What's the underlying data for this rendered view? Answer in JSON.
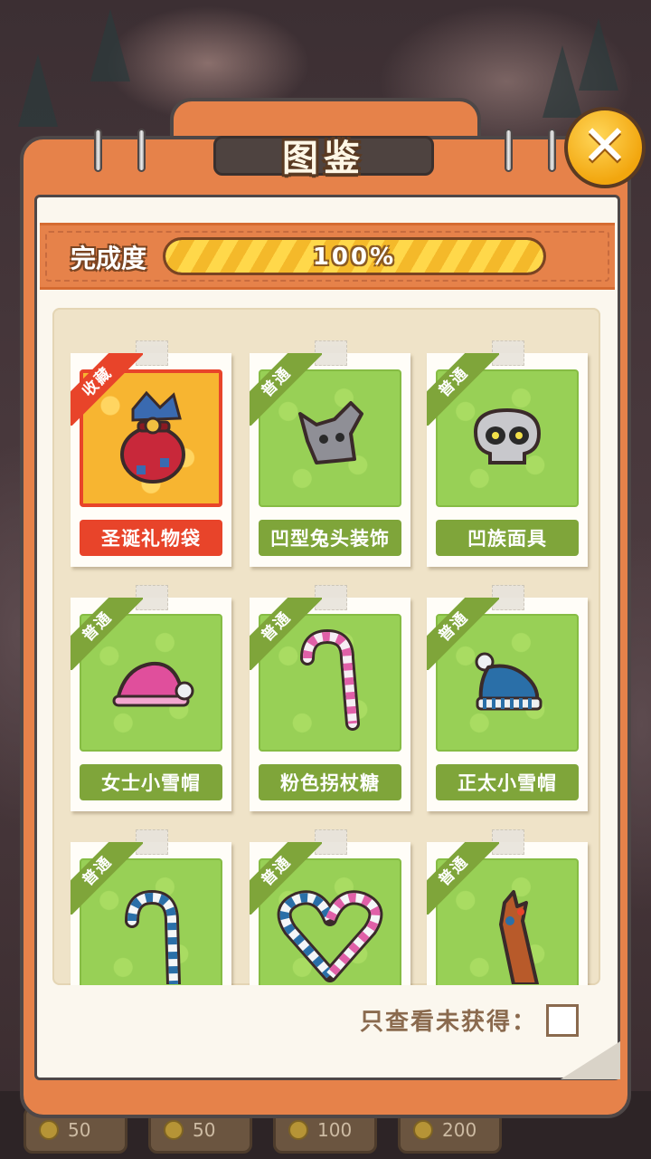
{
  "title": "图鉴",
  "close_symbol": "✕",
  "completion": {
    "label": "完成度",
    "percent": 100,
    "text": "100%"
  },
  "cards": [
    {
      "tag": "收藏",
      "name": "圣诞礼物袋",
      "rarity": "rare",
      "icon": "gift-sack-icon"
    },
    {
      "tag": "普通",
      "name": "凹型兔头装饰",
      "rarity": "common",
      "icon": "rabbit-head-icon"
    },
    {
      "tag": "普通",
      "name": "凹族面具",
      "rarity": "common",
      "icon": "skull-mask-icon"
    },
    {
      "tag": "普通",
      "name": "女士小雪帽",
      "rarity": "common",
      "icon": "pink-santa-hat-icon"
    },
    {
      "tag": "普通",
      "name": "粉色拐杖糖",
      "rarity": "common",
      "icon": "pink-candy-cane-icon"
    },
    {
      "tag": "普通",
      "name": "正太小雪帽",
      "rarity": "common",
      "icon": "blue-beanie-icon"
    },
    {
      "tag": "普通",
      "name": "",
      "rarity": "common",
      "icon": "blue-candy-cane-icon"
    },
    {
      "tag": "普通",
      "name": "",
      "rarity": "common",
      "icon": "candy-cane-heart-icon"
    },
    {
      "tag": "普通",
      "name": "",
      "rarity": "common",
      "icon": "torch-icon"
    }
  ],
  "filter": {
    "label": "只查看未获得：",
    "checked": false
  },
  "shop_prices": [
    "50",
    "50",
    "100",
    "200"
  ],
  "colors": {
    "panel": "#e6824a",
    "common": "#7fa53a",
    "rare": "#e8442a",
    "progress": "#ffd84a"
  }
}
